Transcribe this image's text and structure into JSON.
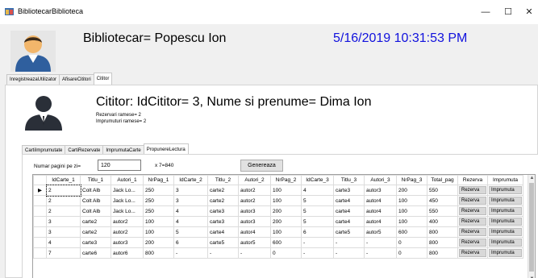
{
  "window": {
    "title": "BibliotecarBiblioteca",
    "min_glyph": "—",
    "max_glyph": "☐",
    "close_glyph": "✕",
    "icon": "app-window-icon"
  },
  "header": {
    "bibliotecar_label": "Bibliotecar= Popescu Ion",
    "datetime": "5/16/2019 10:31:53 PM",
    "datetime_color": "#1111dd"
  },
  "outer_tabs": [
    {
      "label": "InregistreazaUtilizator"
    },
    {
      "label": "AfisareCititori"
    },
    {
      "label": "Cititor"
    }
  ],
  "cititor": {
    "info": "Cititor: IdCititor= 3, Nume si prenume= Dima Ion",
    "rezervari": "Rezervari ramese= 2",
    "imprumuturi": "Imprumuturi ramese= 2"
  },
  "inner_tabs": [
    {
      "label": "CartiImprumutate"
    },
    {
      "label": "CartiRezervate"
    },
    {
      "label": "ImprumutaCarte"
    },
    {
      "label": "PropunereLectura"
    }
  ],
  "form": {
    "pages_label": "Numar pagini pe zi=",
    "pages_value": "120",
    "calc_text": "x 7=840",
    "generate_label": "Genereaza"
  },
  "grid": {
    "columns": [
      "IdCarte_1",
      "Titlu_1",
      "Autori_1",
      "NrPag_1",
      "IdCarte_2",
      "Titlu_2",
      "Autori_2",
      "NrPag_2",
      "IdCarte_3",
      "Titlu_3",
      "Autori_3",
      "NrPag_3",
      "Total_pag",
      "Rezerva",
      "Imprumuta"
    ],
    "current_row_marker": "▶",
    "rows": [
      [
        "2",
        "Colt Alb",
        "Jack Lo...",
        "250",
        "3",
        "carte2",
        "autor2",
        "100",
        "4",
        "carte3",
        "autor3",
        "200",
        "550",
        "Rezerva",
        "Imprumuta"
      ],
      [
        "2",
        "Colt Alb",
        "Jack Lo...",
        "250",
        "3",
        "carte2",
        "autor2",
        "100",
        "5",
        "carte4",
        "autor4",
        "100",
        "450",
        "Rezerva",
        "Imprumuta"
      ],
      [
        "2",
        "Colt Alb",
        "Jack Lo...",
        "250",
        "4",
        "carte3",
        "autor3",
        "200",
        "5",
        "carte4",
        "autor4",
        "100",
        "550",
        "Rezerva",
        "Imprumuta"
      ],
      [
        "3",
        "carte2",
        "autor2",
        "100",
        "4",
        "carte3",
        "autor3",
        "200",
        "5",
        "carte4",
        "autor4",
        "100",
        "400",
        "Rezerva",
        "Imprumuta"
      ],
      [
        "3",
        "carte2",
        "autor2",
        "100",
        "5",
        "carte4",
        "autor4",
        "100",
        "6",
        "carte5",
        "autor5",
        "600",
        "800",
        "Rezerva",
        "Imprumuta"
      ],
      [
        "4",
        "carte3",
        "autor3",
        "200",
        "6",
        "carte5",
        "autor5",
        "600",
        "-",
        "-",
        "-",
        "0",
        "800",
        "Rezerva",
        "Imprumuta"
      ],
      [
        "7",
        "carte6",
        "autor6",
        "800",
        "-",
        "-",
        "-",
        "0",
        "-",
        "-",
        "-",
        "0",
        "800",
        "Rezerva",
        "Imprumuta"
      ]
    ],
    "scroll_up": "▲",
    "scroll_down": "▼"
  }
}
